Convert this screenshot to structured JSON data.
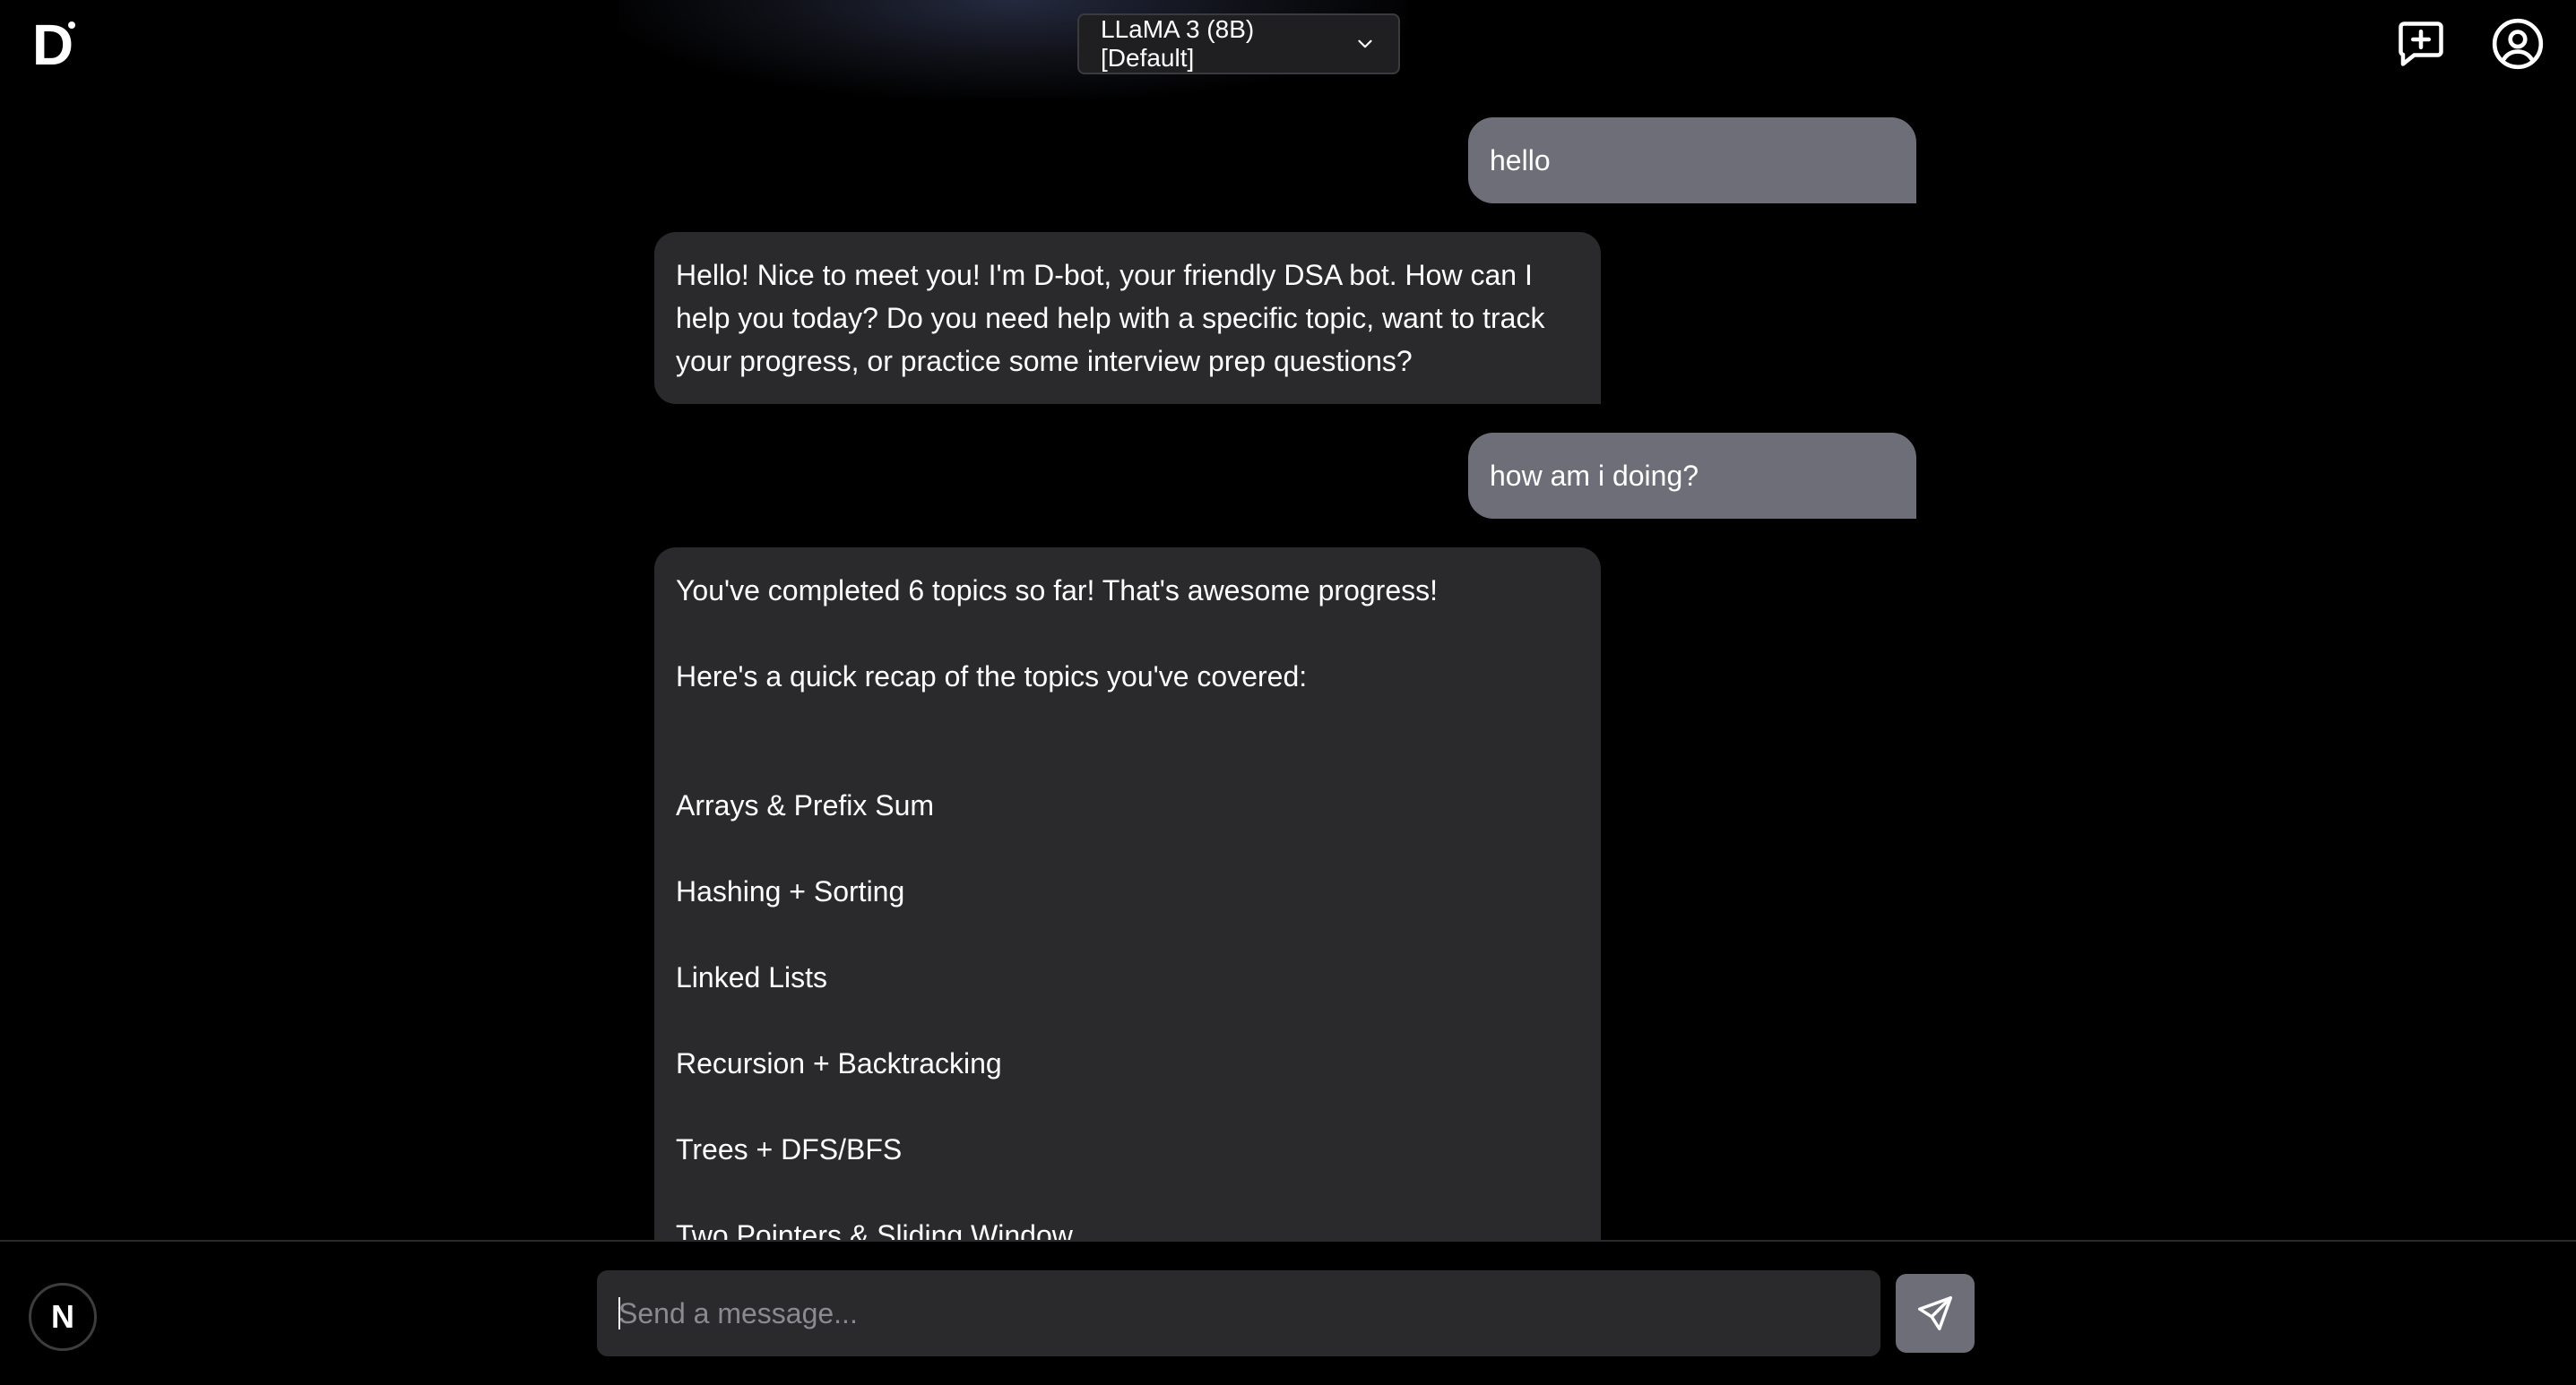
{
  "app": {
    "logo_letter": "D"
  },
  "header": {
    "model_selected": "LLaMA 3 (8B) [Default]",
    "icons": [
      "new-chat-icon",
      "profile-icon"
    ]
  },
  "chat": {
    "messages": [
      {
        "role": "user",
        "text": "hello"
      },
      {
        "role": "assistant",
        "text": "Hello! Nice to meet you! I'm D-bot, your friendly DSA bot. How can I help you today? Do you need help with a specific topic, want to track your progress, or practice some interview prep questions?"
      },
      {
        "role": "user",
        "text": "how am i doing?"
      },
      {
        "role": "assistant",
        "intro": "You've completed 6 topics so far! That's awesome progress!",
        "recap": "Here's a quick recap of the topics you've covered:",
        "topics": [
          "Arrays & Prefix Sum",
          "Hashing + Sorting",
          "Linked Lists",
          "Recursion + Backtracking",
          "Trees + DFS/BFS",
          "Two Pointers & Sliding Window"
        ]
      }
    ]
  },
  "composer": {
    "placeholder": "Send a message...",
    "value": ""
  },
  "footer": {
    "avatar_letter": "N"
  },
  "colors": {
    "background": "#000000",
    "user_bubble": "#6e6e78",
    "bot_bubble": "#2a2a2d",
    "input_bg": "#2a2a2d",
    "send_button": "#6e6e78"
  }
}
